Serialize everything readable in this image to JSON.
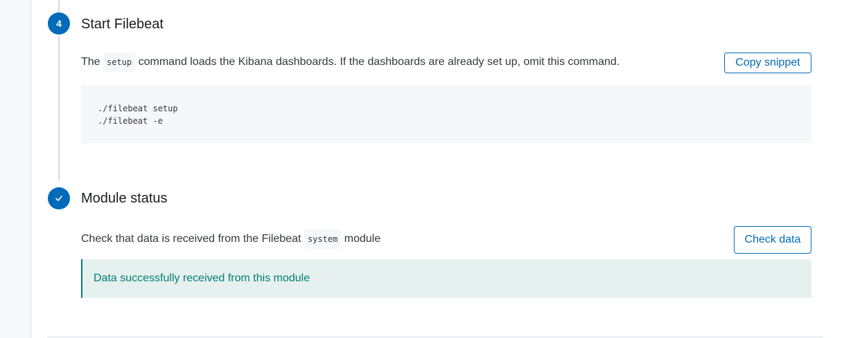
{
  "step4": {
    "number": "4",
    "title": "Start Filebeat",
    "desc_before": "The",
    "desc_code": "setup",
    "desc_after": "command loads the Kibana dashboards. If the dashboards are already set up, omit this command.",
    "copy_label": "Copy snippet",
    "code_lines": [
      "./filebeat setup",
      "./filebeat -e"
    ]
  },
  "module_status": {
    "title": "Module status",
    "check_icon": "check-icon",
    "desc_before": "Check that data is received from the Filebeat",
    "desc_code": "system",
    "desc_after": "module",
    "check_label": "Check data",
    "callout": "Data successfully received from this module"
  },
  "colors": {
    "accent": "#006bb8",
    "success": "#017d73",
    "success_bg": "#e6f1ef"
  }
}
